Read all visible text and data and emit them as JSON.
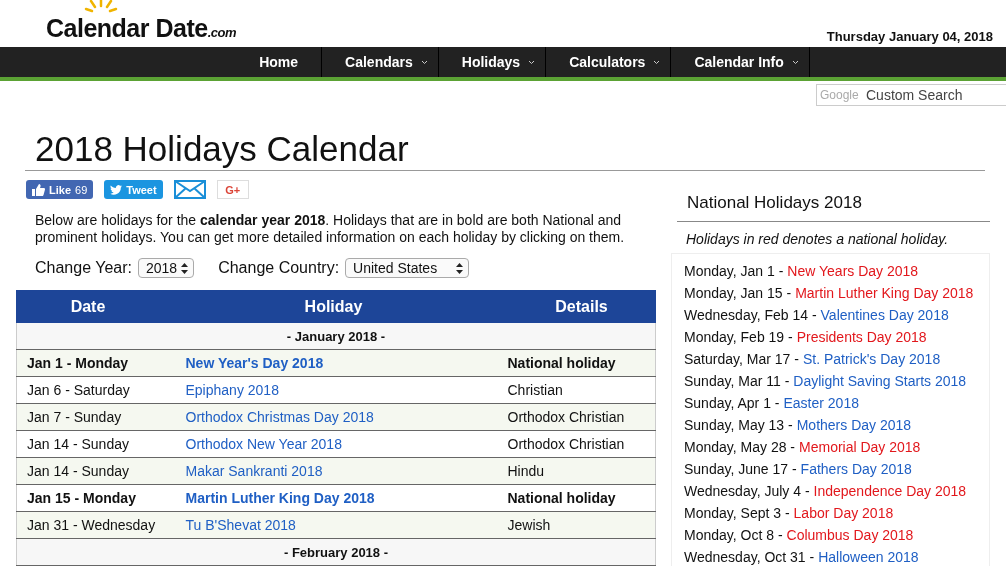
{
  "logo": {
    "name": "Calendar Date",
    "suffix": ".com"
  },
  "date": "Thursday January 04, 2018",
  "nav": [
    {
      "label": "Home",
      "has_menu": false
    },
    {
      "label": "Calendars",
      "has_menu": true
    },
    {
      "label": "Holidays",
      "has_menu": true
    },
    {
      "label": "Calculators",
      "has_menu": true
    },
    {
      "label": "Calendar Info",
      "has_menu": true
    }
  ],
  "search": {
    "brand": "Google",
    "placeholder": "Custom Search"
  },
  "title": "2018 Holidays Calendar",
  "social": {
    "like": "Like",
    "like_count": "69",
    "tweet": "Tweet",
    "gplus": "G+"
  },
  "intro": "Below are holidays for the **calendar year 2018**. Holidays that are in bold are both National and prominent holidays. You can get more detailed information on each holiday by clicking on them.",
  "year_label": "Change Year:",
  "year": "2018",
  "country_label": "Change Country:",
  "country": "United States",
  "table": {
    "columns": [
      "Date",
      "Holiday",
      "Details"
    ],
    "rows": [
      {
        "kind": "month",
        "label": "- January 2018 -"
      },
      {
        "kind": "holiday",
        "bold": true,
        "date": "Jan 1 - Monday",
        "holiday": "New Year's Day 2018",
        "details": "National holiday"
      },
      {
        "kind": "holiday",
        "bold": false,
        "date": "Jan 6 - Saturday",
        "holiday": "Epiphany 2018",
        "details": "Christian"
      },
      {
        "kind": "holiday",
        "bold": false,
        "date": "Jan 7 - Sunday",
        "holiday": "Orthodox Christmas Day 2018",
        "details": "Orthodox Christian"
      },
      {
        "kind": "holiday",
        "bold": false,
        "date": "Jan 14 - Sunday",
        "holiday": "Orthodox New Year 2018",
        "details": "Orthodox Christian"
      },
      {
        "kind": "holiday",
        "bold": false,
        "date": "Jan 14 - Sunday",
        "holiday": "Makar Sankranti 2018",
        "details": "Hindu"
      },
      {
        "kind": "holiday",
        "bold": true,
        "date": "Jan 15 - Monday",
        "holiday": "Martin Luther King Day 2018",
        "details": "National holiday"
      },
      {
        "kind": "holiday",
        "bold": false,
        "date": "Jan 31 - Wednesday",
        "holiday": "Tu B'Shevat 2018",
        "details": "Jewish"
      },
      {
        "kind": "month",
        "label": "- February 2018 -"
      }
    ]
  },
  "national": {
    "title": "National Holidays 2018",
    "note": "Holidays in red denotes a national holiday.",
    "items": [
      {
        "date": "Monday, Jan 1 -",
        "name": "New Years Day 2018",
        "national": true
      },
      {
        "date": "Monday, Jan 15 -",
        "name": "Martin Luther King Day 2018",
        "national": true
      },
      {
        "date": "Wednesday, Feb 14 -",
        "name": "Valentines Day 2018",
        "national": false
      },
      {
        "date": "Monday, Feb 19 -",
        "name": "Presidents Day 2018",
        "national": true
      },
      {
        "date": "Saturday, Mar 17 -",
        "name": "St. Patrick's Day 2018",
        "national": false
      },
      {
        "date": "Sunday, Mar 11 -",
        "name": "Daylight Saving Starts 2018",
        "national": false
      },
      {
        "date": "Sunday, Apr 1 -",
        "name": "Easter 2018",
        "national": false
      },
      {
        "date": "Sunday, May 13 -",
        "name": "Mothers Day 2018",
        "national": false
      },
      {
        "date": "Monday, May 28 -",
        "name": "Memorial Day 2018",
        "national": true
      },
      {
        "date": "Sunday, June 17 -",
        "name": "Fathers Day 2018",
        "national": false
      },
      {
        "date": "Wednesday, July 4 -",
        "name": "Independence Day 2018",
        "national": true
      },
      {
        "date": "Monday, Sept 3 -",
        "name": "Labor Day 2018",
        "national": true
      },
      {
        "date": "Monday, Oct 8 -",
        "name": "Columbus Day 2018",
        "national": true
      },
      {
        "date": "Wednesday, Oct 31 -",
        "name": "Halloween 2018",
        "national": false
      }
    ]
  }
}
